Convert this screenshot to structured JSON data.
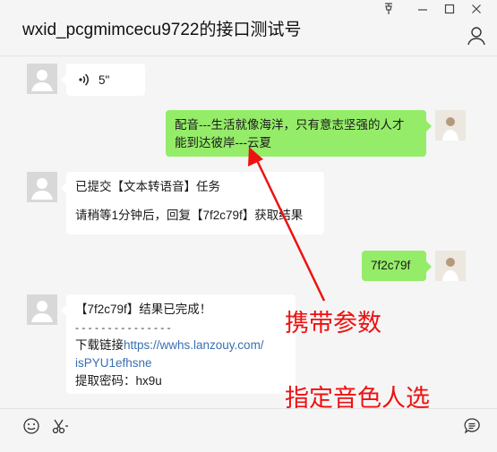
{
  "window": {
    "title": "wxid_pcgmimcecu9722的接口测试号",
    "controls": [
      "pin-icon",
      "minimize-icon",
      "maximize-icon",
      "close-icon"
    ]
  },
  "messages": [
    {
      "side": "left",
      "type": "voice",
      "duration": "5\""
    },
    {
      "side": "right",
      "text_line1": "配音---生活就像海洋，只有意志坚强的人才",
      "text_line2": "能到达彼岸---云夏"
    },
    {
      "side": "left",
      "text_line1": "已提交【文本转语音】任务",
      "text_line2": "请稍等1分钟后，回复【7f2c79f】获取结果"
    },
    {
      "side": "right",
      "text": "7f2c79f"
    },
    {
      "side": "left",
      "line1": "【7f2c79f】结果已完成！",
      "line2": "- - - - - - - - - - - -   - - -",
      "link_label": "下载链接",
      "link_part1": "https://wwhs.lanzouy.com/",
      "link_part2": "isPYU1efhsne",
      "code_label": "提取密码：",
      "code_value": "hx9u"
    }
  ],
  "annotations": {
    "carry_params": "携带参数",
    "voice_select": "指定音色人选",
    "color": "#ee1111"
  },
  "footer": {
    "icons": [
      "emoji-icon",
      "scissors-icon",
      "chat-history-icon"
    ]
  },
  "colors": {
    "green_bubble": "#95ec69",
    "white_bubble": "#ffffff",
    "link": "#3a6fb0"
  }
}
